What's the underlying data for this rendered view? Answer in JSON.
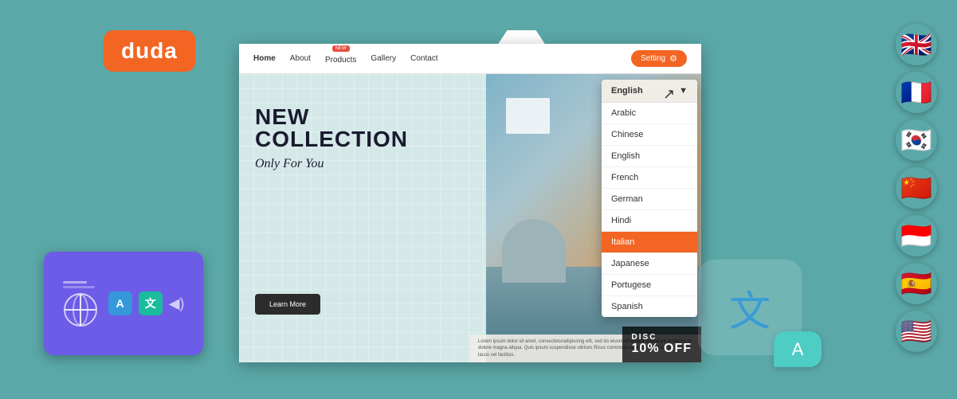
{
  "app": {
    "background_color": "#5ba8a8"
  },
  "duda": {
    "logo_text": "duda"
  },
  "nav": {
    "links": [
      "Home",
      "About",
      "Products",
      "Gallery",
      "Contact"
    ],
    "active": "Home",
    "new_badge": "NEW",
    "setting_label": "Setting"
  },
  "hero": {
    "title_line1": "NEW",
    "title_line2": "COLLECTION",
    "subtitle": "Only For You",
    "cta_label": "Learn More",
    "discount_label": "DISC",
    "discount_value": "10% OFF"
  },
  "footer_text": "Lorem ipsum dolor sit amet, consecteturadipiscing elit, sed do eiusmod tempor incididunt ut labore et dolore magna aliqua. Quis ipsum suspendisse ultrices Risus commodo viverra maecenas accumsan lacus vel facilisis.",
  "dropdown": {
    "header": "English",
    "items": [
      {
        "label": "Arabic",
        "highlighted": false
      },
      {
        "label": "Chinese",
        "highlighted": false
      },
      {
        "label": "English",
        "highlighted": false
      },
      {
        "label": "French",
        "highlighted": false
      },
      {
        "label": "German",
        "highlighted": false
      },
      {
        "label": "Hindi",
        "highlighted": false
      },
      {
        "label": "Italian",
        "highlighted": true
      },
      {
        "label": "Japanese",
        "highlighted": false
      },
      {
        "label": "Portugese",
        "highlighted": false
      },
      {
        "label": "Spanish",
        "highlighted": false
      }
    ]
  },
  "widget": {
    "lang_a": "A",
    "lang_zh": "文"
  },
  "flags": [
    {
      "emoji": "🇬🇧",
      "label": "UK flag"
    },
    {
      "emoji": "🇫🇷",
      "label": "France flag"
    },
    {
      "emoji": "🇰🇷",
      "label": "Korea flag"
    },
    {
      "emoji": "🇨🇳",
      "label": "China flag"
    },
    {
      "emoji": "🇮🇩",
      "label": "Indonesia flag"
    },
    {
      "emoji": "🇪🇸",
      "label": "Spain flag"
    },
    {
      "emoji": "🇺🇸",
      "label": "USA flag"
    }
  ]
}
